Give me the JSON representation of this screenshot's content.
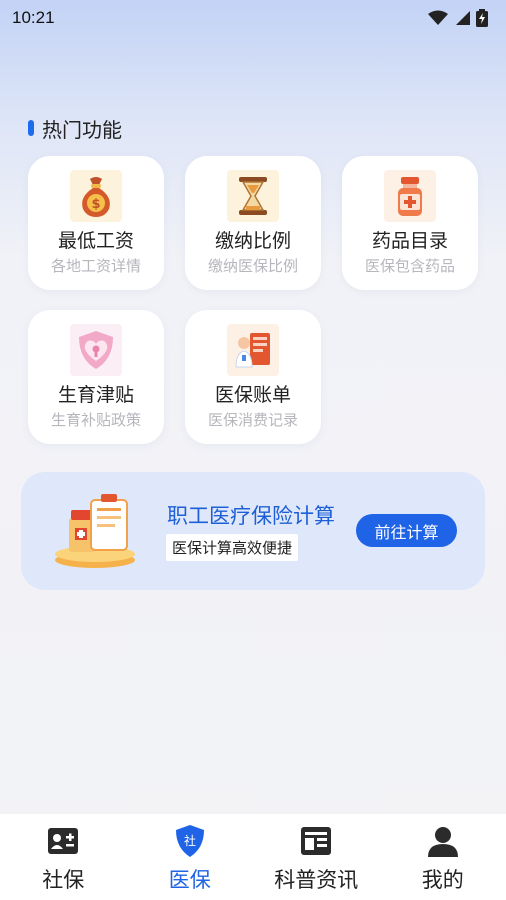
{
  "status_bar": {
    "time": "10:21"
  },
  "section": {
    "title": "热门功能"
  },
  "functions": [
    {
      "title": "最低工资",
      "subtitle": "各地工资详情",
      "icon": "money-bag-icon"
    },
    {
      "title": "缴纳比例",
      "subtitle": "缴纳医保比例",
      "icon": "hourglass-icon"
    },
    {
      "title": "药品目录",
      "subtitle": "医保包含药品",
      "icon": "medicine-bottle-icon"
    },
    {
      "title": "生育津贴",
      "subtitle": "生育补贴政策",
      "icon": "heart-shield-icon"
    },
    {
      "title": "医保账单",
      "subtitle": "医保消费记录",
      "icon": "doctor-bill-icon"
    }
  ],
  "banner": {
    "title": "职工医疗保险计算",
    "subtitle": "医保计算高效便捷",
    "button": "前往计算"
  },
  "tabbar": {
    "items": [
      {
        "label": "社保",
        "icon": "id-card-icon"
      },
      {
        "label": "医保",
        "icon": "shield-icon",
        "badge": "社"
      },
      {
        "label": "科普资讯",
        "icon": "news-icon"
      },
      {
        "label": "我的",
        "icon": "user-icon"
      }
    ],
    "active": "医保"
  },
  "colors": {
    "accent": "#1f63e6",
    "subtitle": "#b6b6bc",
    "banner_bg": "#dfe8fb"
  }
}
